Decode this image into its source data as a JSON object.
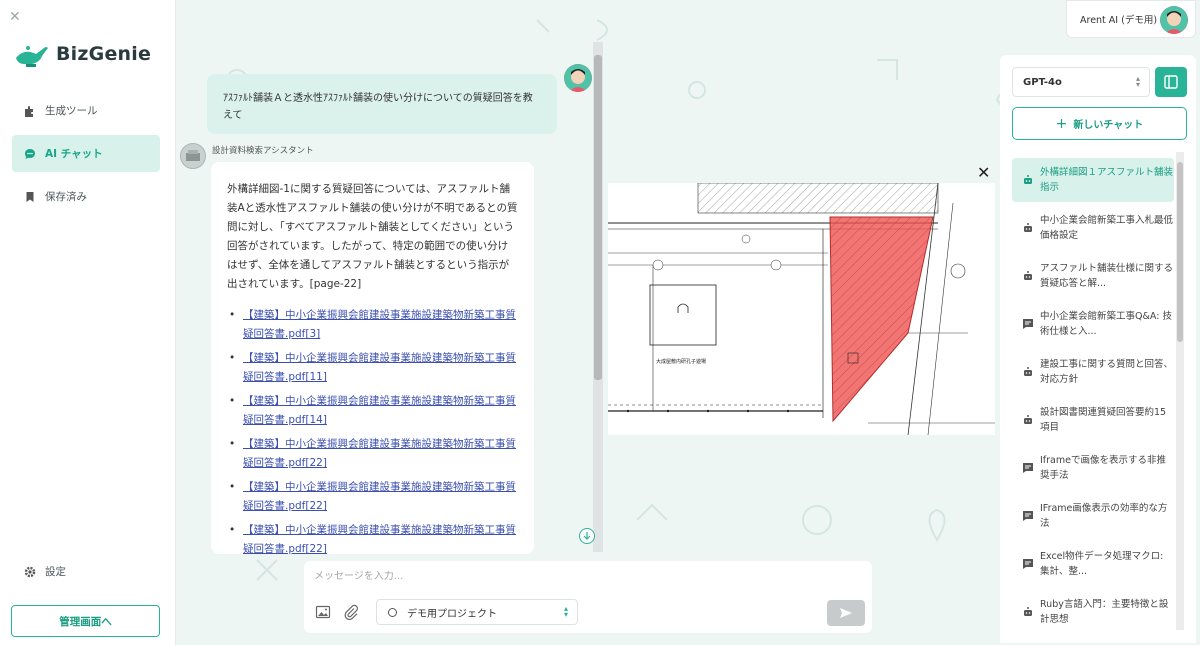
{
  "app": {
    "brand": "BizGenie"
  },
  "sidebar": {
    "items": [
      {
        "label": "生成ツール",
        "icon": "puzzle-icon"
      },
      {
        "label": "AI チャット",
        "icon": "chat-icon",
        "active": true
      },
      {
        "label": "保存済み",
        "icon": "bookmark-icon"
      }
    ],
    "settings_label": "設定",
    "admin_button": "管理画面へ"
  },
  "header": {
    "user_name": "Arent AI (デモ用)"
  },
  "chat": {
    "user_message": "ｱｽﾌｧﾙﾄ舗装Ａと透水性ｱｽﾌｧﾙﾄ舗装の使い分けについての質疑回答を教えて",
    "assistant_name": "設計資料検索アシスタント",
    "answer": "外構詳細図-1に関する質疑回答については、アスファルト舗装Aと透水性アスファルト舗装の使い分けが不明であるとの質問に対し、「すべてアスファルト舗装としてください」という回答がされています。したがって、特定の範囲での使い分けはせず、全体を通してアスファルト舗装とするという指示が出されています。[page-22]",
    "references": [
      {
        "title": "【建築】中小企業振興会館建設事業施設建築物新築工事質疑回答書.pdf",
        "ref": "[3]"
      },
      {
        "title": "【建築】中小企業振興会館建設事業施設建築物新築工事質疑回答書.pdf",
        "ref": "[11]"
      },
      {
        "title": "【建築】中小企業振興会館建設事業施設建築物新築工事質疑回答書.pdf",
        "ref": "[14]"
      },
      {
        "title": "【建築】中小企業振興会館建設事業施設建築物新築工事質疑回答書.pdf",
        "ref": "[22]"
      },
      {
        "title": "【建築】中小企業振興会館建設事業施設建築物新築工事質疑回答書.pdf",
        "ref": "[22]"
      },
      {
        "title": "【建築】中小企業振興会館建設事業施設建築物新築工事質疑回答書.pdf",
        "ref": "[22]"
      }
    ]
  },
  "composer": {
    "placeholder": "メッセージを入力...",
    "project": "デモ用プロジェクト"
  },
  "right_panel": {
    "model": "GPT-4o",
    "new_chat": "新しいチャット",
    "history": [
      {
        "label": "外構詳細図１アスファルト舗装指示",
        "icon": "bot-icon",
        "active": true
      },
      {
        "label": "中小企業会館新築工事入札最低価格設定",
        "icon": "bot-icon"
      },
      {
        "label": "アスファルト舗装仕様に関する質疑応答と解...",
        "icon": "bot-icon"
      },
      {
        "label": "中小企業会館新築工事Q&A: 技術仕様と入...",
        "icon": "message-icon"
      },
      {
        "label": "建設工事に関する質問と回答、対応方針",
        "icon": "bot-icon"
      },
      {
        "label": "設計図書関連質疑回答要約15項目",
        "icon": "bot-icon"
      },
      {
        "label": "Iframeで画像を表示する非推奨手法",
        "icon": "message-icon"
      },
      {
        "label": "IFrame画像表示の効率的な方法",
        "icon": "message-icon"
      },
      {
        "label": "Excel物件データ処理マクロ: 集計、整...",
        "icon": "message-icon"
      },
      {
        "label": "Ruby言語入門：主要特徴と設計思想",
        "icon": "bot-icon"
      }
    ]
  },
  "preview": {
    "room_label": "大成屋敷内研孔子遊場"
  },
  "colors": {
    "accent": "#2ab497",
    "active_bg": "#d8f1eb",
    "highlight": "#ef5350"
  }
}
